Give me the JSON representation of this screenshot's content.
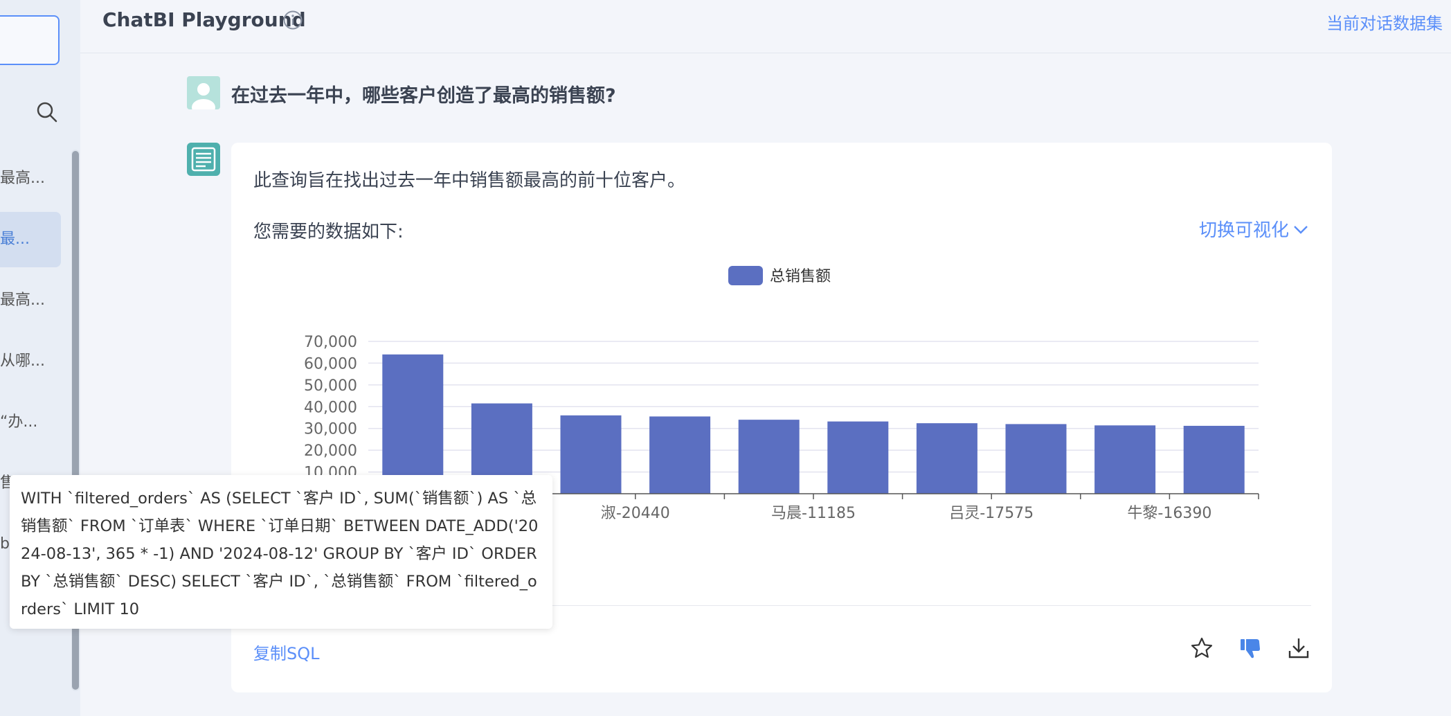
{
  "header": {
    "title": "ChatBI Playground",
    "dataset_link": "当前对话数据集"
  },
  "sidebar": {
    "items": [
      {
        "label": "最高..."
      },
      {
        "label": "最..."
      },
      {
        "label": "最高..."
      },
      {
        "label": "从哪..."
      },
      {
        "label": "“办..."
      },
      {
        "label": "售"
      },
      {
        "label": "b"
      }
    ]
  },
  "conversation": {
    "user_question": "在过去一年中，哪些客户创造了最高的销售额?",
    "answer_summary": "此查询旨在找出过去一年中销售额最高的前十位客户。",
    "data_intro": "您需要的数据如下:",
    "toggle_viz": "切换可视化",
    "copy_sql": "复制SQL",
    "sql_tooltip": "WITH `filtered_orders` AS (SELECT `客户 ID`, SUM(`销售额`) AS `总销售额` FROM `订单表` WHERE `订单日期` BETWEEN DATE_ADD('2024-08-13', 365 * -1) AND '2024-08-12' GROUP BY `客户 ID` ORDER BY `总销售额` DESC) SELECT `客户 ID`, `总销售额` FROM `filtered_orders` LIMIT 10"
  },
  "icons": {
    "info": "info-icon",
    "search": "search-icon",
    "star": "star-icon",
    "thumbs_down": "thumbs-down-icon",
    "download": "download-icon",
    "chevron": "chevron-down-icon"
  },
  "colors": {
    "accent": "#5b8ff9",
    "bar": "#5b6fc1",
    "text_dark": "#3b4352"
  },
  "chart_data": {
    "type": "bar",
    "legend": [
      "总销售额"
    ],
    "legend_position": "top-center",
    "categories": [
      "",
      "",
      "淑-20440",
      "",
      "马晨-11185",
      "",
      "吕灵-17575",
      "",
      "牛黎-16390",
      ""
    ],
    "series": [
      {
        "name": "总销售额",
        "values": [
          64000,
          41500,
          36000,
          35500,
          34000,
          33200,
          32400,
          32000,
          31400,
          31200
        ]
      }
    ],
    "yticks": [
      "10,000",
      "20,000",
      "30,000",
      "40,000",
      "50,000",
      "60,000",
      "70,000"
    ],
    "ylim": [
      0,
      70000
    ],
    "grid": true
  }
}
